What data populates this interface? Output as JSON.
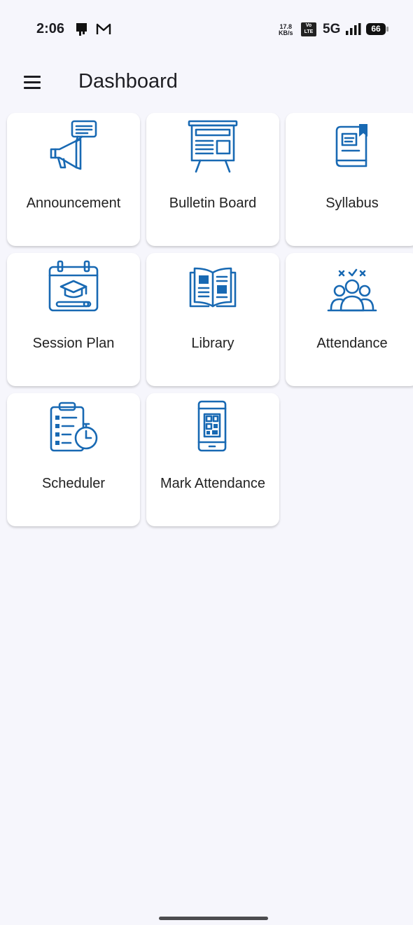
{
  "status_bar": {
    "time": "2:06",
    "net_speed_value": "17.8",
    "net_speed_unit": "KB/s",
    "volte_top": "Vo",
    "volte_bottom": "LTE",
    "network": "5G",
    "battery": "66",
    "icons": [
      "notification-icon",
      "gmail-icon",
      "signal-icon",
      "battery-icon"
    ]
  },
  "app_bar": {
    "title": "Dashboard",
    "menu_icon": "hamburger-menu-icon"
  },
  "tiles": [
    {
      "label": "Announcement",
      "icon": "megaphone-icon"
    },
    {
      "label": "Bulletin Board",
      "icon": "bulletin-board-icon"
    },
    {
      "label": "Syllabus",
      "icon": "syllabus-book-icon"
    },
    {
      "label": "Session Plan",
      "icon": "session-plan-calendar-icon"
    },
    {
      "label": "Library",
      "icon": "open-book-icon"
    },
    {
      "label": "Attendance",
      "icon": "attendance-group-icon"
    },
    {
      "label": "Scheduler",
      "icon": "clipboard-stopwatch-icon"
    },
    {
      "label": "Mark Attendance",
      "icon": "phone-qr-code-icon"
    }
  ],
  "colors": {
    "background": "#f6f6fc",
    "card": "#ffffff",
    "icon_accent": "#1869b3",
    "text": "#1d1d22"
  }
}
